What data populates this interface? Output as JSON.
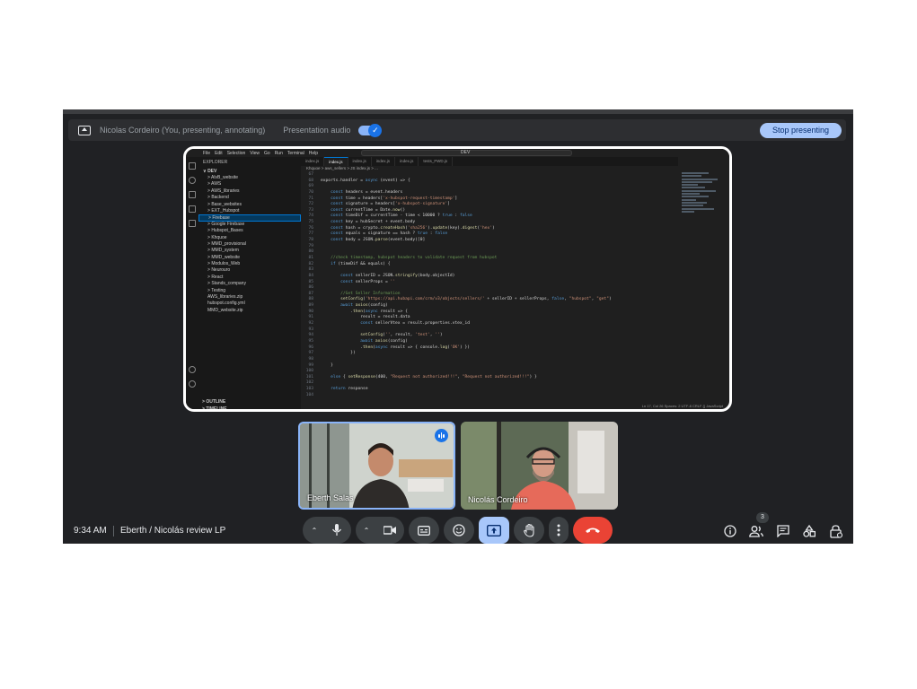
{
  "presenting_bar": {
    "presenter_status": "Nicolas Cordeiro (You, presenting, annotating)",
    "audio_label": "Presentation audio",
    "audio_enabled": true,
    "stop_label": "Stop presenting"
  },
  "shared_screen": {
    "menu": [
      "File",
      "Edit",
      "Selection",
      "View",
      "Go",
      "Run",
      "Terminal",
      "Help"
    ],
    "search": "DEV",
    "explorer_header": "EXPLORER",
    "root_folder": "DEV",
    "folders": [
      "AlvB_website",
      "AWS",
      "AWS_libraries",
      "Backend",
      "Base_websites",
      "EXT_Hubspot",
      "Firebase",
      "Google Firebase",
      "Hubspot_Bases",
      "Khquoe",
      "MMD_provisional",
      "MMD_system",
      "MMD_website",
      "Modulos_Web",
      "Neurouro",
      "React",
      "Stands_company",
      "Testing"
    ],
    "files": [
      "AWS_libraries.zip",
      "hubspot.config.yml",
      "MMD_website.zip"
    ],
    "outline_label": "OUTLINE",
    "timeline_label": "TIMELINE",
    "tabs": [
      "index.js",
      "index.js",
      "index.js",
      "index.js",
      "index.js",
      "tests_FWD.js"
    ],
    "breadcrumb": "Khquoe > aws_sellers > JS index.js > ...",
    "status": "Ln 17, Col 26   Spaces: 2   UTF-8   CRLF   {} JavaScript",
    "code": [
      {
        "n": "67",
        "t": ""
      },
      {
        "n": "68",
        "t": "exports.handler = async (event) => {"
      },
      {
        "n": "69",
        "t": ""
      },
      {
        "n": "70",
        "t": "    const headers = event.headers"
      },
      {
        "n": "71",
        "t": "    const time = headers['x-hubspot-request-timestamp']"
      },
      {
        "n": "72",
        "t": "    const signature = headers['x-hubspot-signature']"
      },
      {
        "n": "73",
        "t": "    const currentTime = Date.now()"
      },
      {
        "n": "74",
        "t": "    const timeDif = currentTime - time < 10000 ? true : false"
      },
      {
        "n": "75",
        "t": "    const key = hubSecret + event.body"
      },
      {
        "n": "76",
        "t": "    const hash = crypto.createHash('sha256').update(key).digest('hex')"
      },
      {
        "n": "77",
        "t": "    const equals = signature == hash ? true : false"
      },
      {
        "n": "78",
        "t": "    const body = JSON.parse(event.body)[0]"
      },
      {
        "n": "79",
        "t": ""
      },
      {
        "n": "80",
        "t": ""
      },
      {
        "n": "81",
        "t": "    //check timestamp, hubspot headers to validate request from hubspot"
      },
      {
        "n": "82",
        "t": "    if (timeDif && equals) {"
      },
      {
        "n": "83",
        "t": ""
      },
      {
        "n": "84",
        "t": "        const sellerID = JSON.stringify(body.objectId)"
      },
      {
        "n": "85",
        "t": "        const sellerProps = ''"
      },
      {
        "n": "86",
        "t": ""
      },
      {
        "n": "87",
        "t": "        //Get Seller Information"
      },
      {
        "n": "88",
        "t": "        setConfig('https://api.hubapi.com/crm/v3/objects/sellers/' + sellerID + sellerProps, false, \"hubspot\", \"get\")"
      },
      {
        "n": "89",
        "t": "        await axios(config)"
      },
      {
        "n": "90",
        "t": "            .then(async result => {"
      },
      {
        "n": "91",
        "t": "                result = result.data"
      },
      {
        "n": "92",
        "t": "                const sellerVtex = result.properties.vtex_id"
      },
      {
        "n": "93",
        "t": ""
      },
      {
        "n": "94",
        "t": "                setConfig('', result, 'test', '')"
      },
      {
        "n": "95",
        "t": "                await axios(config)"
      },
      {
        "n": "96",
        "t": "                .then(async result => { console.log('OK') })"
      },
      {
        "n": "97",
        "t": "            })"
      },
      {
        "n": "98",
        "t": ""
      },
      {
        "n": "99",
        "t": "    }"
      },
      {
        "n": "100",
        "t": ""
      },
      {
        "n": "101",
        "t": "    else { setResponse(400, \"Request not authorized!!!\", \"Request not authorized!!!\") }"
      },
      {
        "n": "102",
        "t": ""
      },
      {
        "n": "103",
        "t": "    return response"
      },
      {
        "n": "104",
        "t": ""
      }
    ]
  },
  "participants": [
    {
      "name": "Eberth Salas",
      "speaking": true
    },
    {
      "name": "Nicolás Cordeiro",
      "speaking": false
    }
  ],
  "meeting": {
    "time": "9:34 AM",
    "title": "Eberth / Nicolás review LP",
    "people_count": "3"
  },
  "controls": [
    "mic-options",
    "microphone",
    "camera-options",
    "camera",
    "captions",
    "reactions",
    "present",
    "raise-hand",
    "more-options",
    "leave-call"
  ],
  "right_controls": [
    "meeting-details",
    "people",
    "chat",
    "activities",
    "host-controls"
  ],
  "colors": {
    "background": "#202124",
    "accent": "#8ab4f8",
    "leave": "#ea4335",
    "present_active": "#a8c7fa"
  }
}
